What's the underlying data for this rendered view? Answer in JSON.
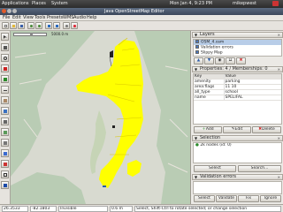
{
  "system_bar": {
    "apps_label": "Applications",
    "places_label": "Places",
    "system_label": "System",
    "clock": "Mon Jan 4, 9:23 PM",
    "username": "mikepwest"
  },
  "window": {
    "title": "Java OpenStreetMap Editor"
  },
  "menu": [
    "File",
    "Edit",
    "View",
    "Tools",
    "Presets",
    "WMS",
    "Audio",
    "Help"
  ],
  "toolbar_icons": [
    "new-icon",
    "open-icon",
    "save-icon",
    "undo-icon",
    "redo-icon",
    "download-icon",
    "upload-icon",
    "preferences-icon",
    "help-icon"
  ],
  "left_tools": [
    "select-icon",
    "move-icon",
    "zoom-icon",
    "delete-icon",
    "add-icon",
    "line-icon",
    "building-icon",
    "toggle-icon",
    "extrude-icon",
    "layers-icon",
    "parallel-icon",
    "validate-icon",
    "draw-icon",
    "lasso-icon",
    "check-icon"
  ],
  "map": {
    "scale_label": "5000.0 m"
  },
  "layers_panel": {
    "title": "Layers",
    "items": [
      {
        "name": "OSM_4.osm",
        "checked": true,
        "selected": true
      },
      {
        "name": "Validation errors",
        "checked": true,
        "selected": false
      },
      {
        "name": "Slippy Map",
        "checked": true,
        "selected": false
      }
    ]
  },
  "properties_panel": {
    "title": "Properties: 4 / Memberships: 0",
    "rows": [
      {
        "key": "Key",
        "value": "Value"
      },
      {
        "key": "amenity",
        "value": "parking"
      },
      {
        "key": "area:flags",
        "value": "11 10"
      },
      {
        "key": "all_type",
        "value": "school"
      },
      {
        "key": "name",
        "value": "SPELIFAL"
      }
    ],
    "add_label": "Add",
    "edit_label": "Edit",
    "delete_label": "Delete"
  },
  "selection_panel": {
    "title": "Selection",
    "items": [
      "2k nodes (id: 0)"
    ],
    "select_label": "Select",
    "search_label": "Search..."
  },
  "validation_panel": {
    "title": "Validation errors",
    "buttons": [
      "Select",
      "Validate",
      "Fix",
      "Ignore"
    ]
  },
  "status": {
    "lat": "26.3533",
    "lon": "-82.1803",
    "mode": "Invisible",
    "distance": "0.6 m",
    "help": "Select, Shift-Ctrl to rotate selected; or change selection"
  },
  "colors": {
    "water": "#d8dad0",
    "land": "#b9ccb4",
    "osm_data": "#ffff00",
    "selection_highlight": "#4a78c0"
  }
}
